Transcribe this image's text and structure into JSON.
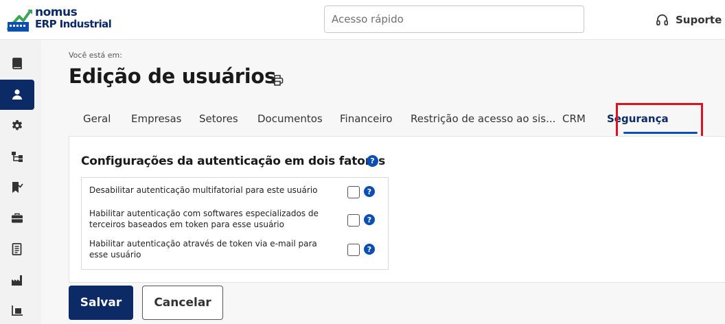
{
  "app": {
    "brand_line1": "nomus",
    "brand_line2": "ERP Industrial"
  },
  "header": {
    "quick_access_placeholder": "Acesso rápido",
    "support_label": "Suporte"
  },
  "sidebar": {
    "items": [
      {
        "icon": "book-icon",
        "active": false
      },
      {
        "icon": "user-icon",
        "active": true
      },
      {
        "icon": "gear-icon",
        "active": false
      },
      {
        "icon": "hierarchy-icon",
        "active": false
      },
      {
        "icon": "bookmark-check-icon",
        "active": false
      },
      {
        "icon": "briefcase-icon",
        "active": false
      },
      {
        "icon": "document-icon",
        "active": false
      },
      {
        "icon": "factory-icon",
        "active": false
      },
      {
        "icon": "forklift-icon",
        "active": false
      }
    ]
  },
  "page": {
    "breadcrumb": "Você está em:",
    "title": "Edição de usuários"
  },
  "tabs": [
    {
      "label": "Geral"
    },
    {
      "label": "Empresas"
    },
    {
      "label": "Setores"
    },
    {
      "label": "Documentos"
    },
    {
      "label": "Financeiro"
    },
    {
      "label": "Restrição de acesso ao sis..."
    },
    {
      "label": "CRM"
    },
    {
      "label": "Segurança",
      "active": true
    }
  ],
  "two_factor": {
    "title": "Configurações da autenticação em dois fatores",
    "help_glyph": "?",
    "options": [
      {
        "label": "Desabilitar autenticação multifatorial para este usuário",
        "checked": false
      },
      {
        "label": "Habilitar autenticação com softwares especializados de terceiros baseados em token para esse usuário",
        "checked": false
      },
      {
        "label": "Habilitar autenticação através de token via e-mail para esse usuário",
        "checked": false
      }
    ]
  },
  "actions": {
    "save_label": "Salvar",
    "cancel_label": "Cancelar"
  },
  "colors": {
    "brand_navy": "#0b2a66",
    "accent_blue": "#0b4fb3",
    "highlight_red": "#e0101f",
    "logo_green": "#3aa655"
  }
}
